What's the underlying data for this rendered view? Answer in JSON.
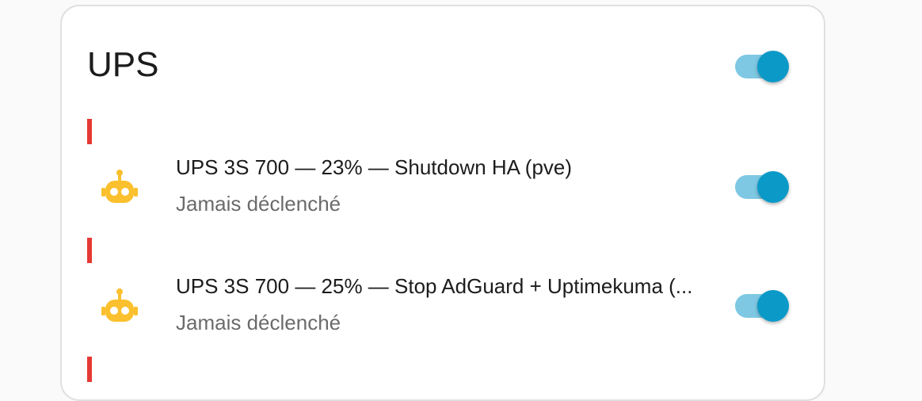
{
  "card": {
    "title": "UPS",
    "header_toggle_on": true
  },
  "automations": [
    {
      "name": "UPS 3S 700 — 23% — Shutdown HA (pve)",
      "status": "Jamais déclenché",
      "enabled": true
    },
    {
      "name": "UPS 3S 700 — 25% — Stop AdGuard + Uptimekuma (...",
      "status": "Jamais déclenché",
      "enabled": true
    }
  ],
  "colors": {
    "accent": "#0b9ac8",
    "accent_track": "#7ec8e3",
    "robot_icon": "#fbc02d",
    "status_bar": "#e53935"
  },
  "icons": {
    "automation": "robot-icon"
  }
}
